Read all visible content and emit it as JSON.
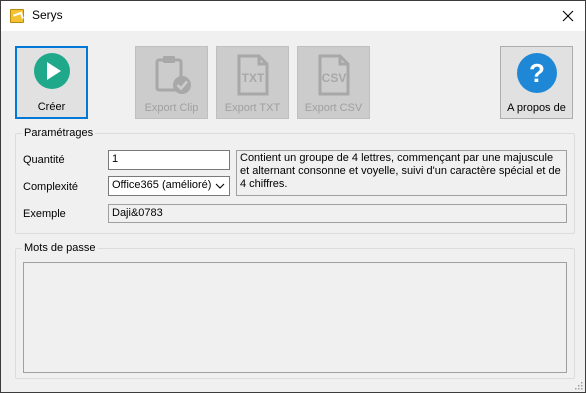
{
  "window": {
    "title": "Serys"
  },
  "toolbar": {
    "create_label": "Créer",
    "export_clip_label": "Export Clip",
    "export_txt_label": "Export TXT",
    "export_csv_label": "Export CSV",
    "about_label": "A propos de",
    "txt_icon_text": "TXT",
    "csv_icon_text": "CSV",
    "help_icon_text": "?"
  },
  "settings": {
    "group_title": "Paramétrages",
    "quantity_label": "Quantité",
    "quantity_value": "1",
    "complexity_label": "Complexité",
    "complexity_selected": "Office365 (amélioré)",
    "description": "Contient un groupe de 4 lettres, commençant par une majuscule et alternant consonne et voyelle, suivi d'un caractère spécial et de 4 chiffres.",
    "example_label": "Exemple",
    "example_value": "Daji&0783"
  },
  "passwords": {
    "group_title": "Mots de passe"
  },
  "colors": {
    "accent": "#0078d7",
    "create_icon": "#1fa98a",
    "help_icon": "#1e88d6"
  }
}
